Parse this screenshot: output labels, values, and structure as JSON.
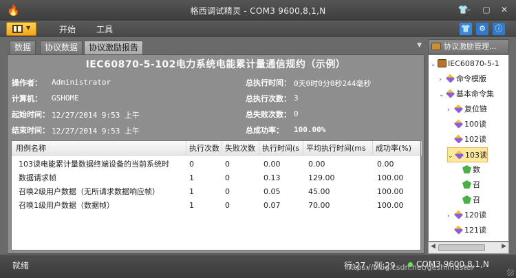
{
  "window": {
    "title": "格西调试精灵 - COM3  9600,8,1,N",
    "controls": {
      "minimize": "–",
      "maximize": "▢",
      "close": "✕"
    }
  },
  "menubar": {
    "items": [
      "开始",
      "工具"
    ],
    "ribbon_icons": [
      "shirt-icon",
      "settings-icon",
      "about-icon"
    ]
  },
  "tabs": [
    {
      "label": "数据",
      "active": false
    },
    {
      "label": "协议数据",
      "active": false
    },
    {
      "label": "协议激励报告",
      "active": true
    }
  ],
  "report": {
    "title": "IEC60870-5-102电力系统电能累计量通信规约（示例）",
    "left_fields": [
      {
        "label": "操作者：",
        "value": "Administrator"
      },
      {
        "label": "计算机：",
        "value": "GSHOME"
      },
      {
        "label": "起始时间：",
        "value": "12/27/2014 9:53 上午"
      },
      {
        "label": "结束时间：",
        "value": "12/27/2014 9:53 上午"
      }
    ],
    "right_fields": [
      {
        "label": "总执行时间：",
        "value": "0天0时0分0秒244毫秒"
      },
      {
        "label": "总执行次数：",
        "value": "3"
      },
      {
        "label": "总失败次数：",
        "value": "0"
      },
      {
        "label": "总成功率：",
        "value": "100.00%"
      }
    ]
  },
  "table": {
    "columns": [
      "用例名称",
      "执行次数",
      "失败次数",
      "执行时间(s",
      "平均执行时间(ms",
      "成功率(%)"
    ],
    "rows": [
      [
        "103读电能累计量数据终端设备的当前系统时",
        "0",
        "0",
        "0.00",
        "0.00",
        "0.00"
      ],
      [
        "数据请求帧",
        "1",
        "0",
        "0.13",
        "129.00",
        "100.00"
      ],
      [
        "召唤2级用户数据（无所请求数据响应帧）",
        "1",
        "0",
        "0.05",
        "45.00",
        "100.00"
      ],
      [
        "召唤1级用户数据（数据帧）",
        "1",
        "0",
        "0.07",
        "70.00",
        "100.00"
      ]
    ]
  },
  "tree": {
    "header": "协议激励管理...",
    "nodes": [
      {
        "label": "IEC60870-5-1",
        "level": 0,
        "expander": "⌄",
        "icon": "suitcase-icon",
        "selected": false
      },
      {
        "label": "命令模版",
        "level": 1,
        "expander": "›",
        "icon": "diamond-icon",
        "selected": false
      },
      {
        "label": "基本命令集",
        "level": 1,
        "expander": "⌄",
        "icon": "diamond-icon",
        "selected": false
      },
      {
        "label": "复位链",
        "level": 2,
        "expander": "›",
        "icon": "diamond-icon",
        "selected": false
      },
      {
        "label": "100读",
        "level": 2,
        "expander": "",
        "icon": "diamond-icon",
        "selected": false
      },
      {
        "label": "102读",
        "level": 2,
        "expander": "",
        "icon": "diamond-icon",
        "selected": false
      },
      {
        "label": "103读",
        "level": 2,
        "expander": "⌄",
        "icon": "diamond-icon",
        "selected": true
      },
      {
        "label": "数",
        "level": 3,
        "expander": "",
        "icon": "gem-icon",
        "selected": false
      },
      {
        "label": "召",
        "level": 3,
        "expander": "",
        "icon": "gem-icon",
        "selected": false
      },
      {
        "label": "召",
        "level": 3,
        "expander": "",
        "icon": "gem-icon",
        "selected": false
      },
      {
        "label": "120读",
        "level": 2,
        "expander": "›",
        "icon": "diamond-icon",
        "selected": false
      },
      {
        "label": "121读",
        "level": 2,
        "expander": "",
        "icon": "diamond-icon",
        "selected": false
      }
    ]
  },
  "statusbar": {
    "ready": "就绪",
    "cursor": "行:27，列:29",
    "port": "COM3 9600,8,1,N",
    "watermark": "https://blog.csdn.net/geshimaster"
  }
}
